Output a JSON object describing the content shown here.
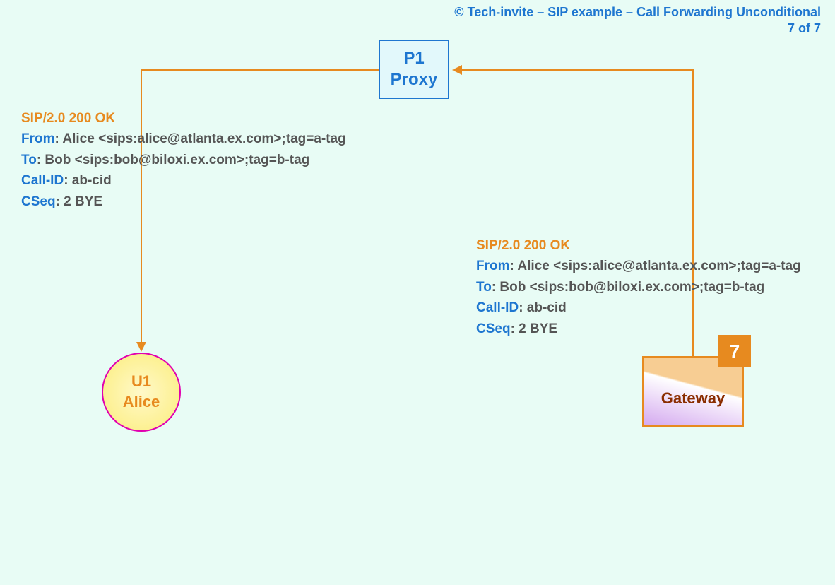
{
  "header": {
    "copyright": "© Tech-invite – SIP example – Call Forwarding Unconditional",
    "page": "7 of 7"
  },
  "proxy": {
    "line1": "P1",
    "line2": "Proxy"
  },
  "msg_left": {
    "status": "SIP/2.0 200 OK",
    "from_key": "From",
    "from_val": ": Alice <sips:alice@atlanta.ex.com>;tag=a-tag",
    "to_key": "To",
    "to_val": ": Bob <sips:bob@biloxi.ex.com>;tag=b-tag",
    "callid_key": "Call-ID",
    "callid_val": ": ab-cid",
    "cseq_key": "CSeq",
    "cseq_val": ": 2 BYE"
  },
  "msg_right": {
    "status": "SIP/2.0 200 OK",
    "from_key": "From",
    "from_val": ": Alice <sips:alice@atlanta.ex.com>;tag=a-tag",
    "to_key": "To",
    "to_val": ": Bob <sips:bob@biloxi.ex.com>;tag=b-tag",
    "callid_key": "Call-ID",
    "callid_val": ": ab-cid",
    "cseq_key": "CSeq",
    "cseq_val": ": 2 BYE"
  },
  "alice": {
    "line1": "U1",
    "line2": "Alice"
  },
  "gateway": {
    "label": "Gateway"
  },
  "step": {
    "number": "7"
  }
}
